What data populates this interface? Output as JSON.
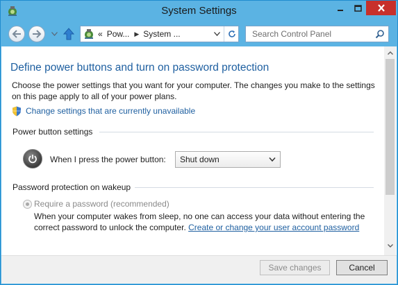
{
  "window": {
    "title": "System Settings"
  },
  "titlebar": {
    "buttons": [
      "minimize-icon",
      "maximize-icon",
      "close-icon"
    ],
    "close_color": "#c7302b"
  },
  "nav": {
    "breadcrumb_chevron": "«",
    "breadcrumb": [
      "Pow...",
      "System ..."
    ],
    "search_placeholder": "Search Control Panel"
  },
  "content": {
    "heading": "Define power buttons and turn on password protection",
    "description": "Choose the power settings that you want for your computer. The changes you make to the settings on this page apply to all of your power plans.",
    "change_link": "Change settings that are currently unavailable",
    "power_section_title": "Power button settings",
    "power_label": "When I press the power button:",
    "power_option": "Shut down",
    "password_section_title": "Password protection on wakeup",
    "require_password_label": "Require a password (recommended)",
    "wake_text": "When your computer wakes from sleep, no one can access your data without entering the correct password to unlock the computer.",
    "account_link": "Create or change your user account password"
  },
  "footer": {
    "save_label": "Save changes",
    "cancel_label": "Cancel"
  },
  "colors": {
    "chrome": "#5bb3e3",
    "link": "#1e5fa0"
  }
}
